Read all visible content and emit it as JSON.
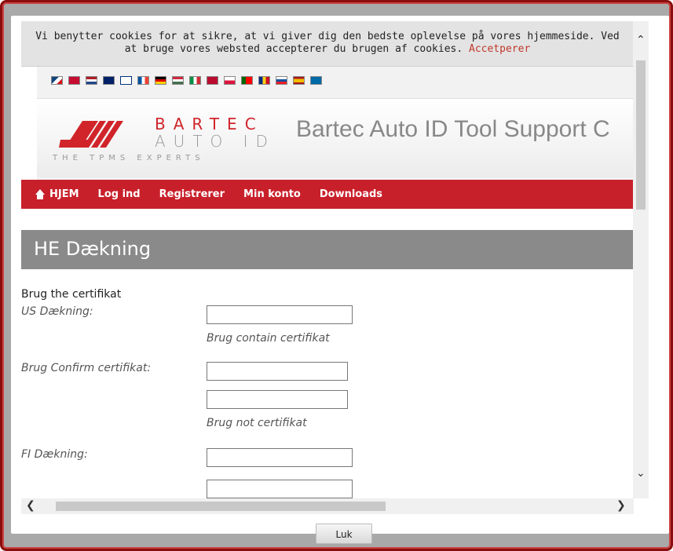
{
  "cookie": {
    "text_line1": "Vi benytter cookies for at sikre, at vi giver dig den bedste oplevelse på vores hjemmeside. Ved",
    "text_line2": "at bruge vores websted accepterer du brugen af cookies.",
    "accept_label": "Accetperer"
  },
  "flags": [
    "flag-cz",
    "flag-dk",
    "flag-nl",
    "flag-gb",
    "flag-fi",
    "flag-fr",
    "flag-de",
    "flag-hu",
    "flag-it",
    "flag-no",
    "flag-pl",
    "flag-pt",
    "flag-ro",
    "flag-sk",
    "flag-es",
    "flag-se"
  ],
  "header": {
    "logo_word1": "BARTEC",
    "logo_word2": "AUTO ID",
    "logo_tagline": "THE TPMS EXPERTS",
    "site_title": "Bartec Auto ID Tool Support C"
  },
  "nav": {
    "home": "HJEM",
    "login": "Log ind",
    "register": "Registrerer",
    "account": "Min konto",
    "downloads": "Downloads"
  },
  "section": {
    "title": "HE Dækning"
  },
  "form": {
    "intro": "Brug the certifikat",
    "us_label": "US Dækning:",
    "us_hint": "Brug contain certifikat",
    "confirm_label": "Brug Confirm certifikat:",
    "confirm_hint": "Brug not certifikat",
    "fi_label": "FI Dækning:"
  },
  "dialog": {
    "close_label": "Luk"
  },
  "colors": {
    "brand_red": "#c8202b",
    "frame_red": "#8a0e0e",
    "section_gray": "#8a8a8a"
  }
}
